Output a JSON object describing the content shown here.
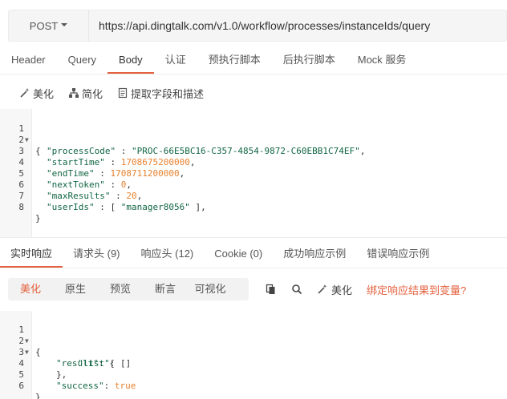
{
  "url_bar": {
    "method": "POST",
    "url": "https://api.dingtalk.com/v1.0/workflow/processes/instanceIds/query"
  },
  "request_tabs": [
    "Header",
    "Query",
    "Body",
    "认证",
    "预执行脚本",
    "后执行脚本",
    "Mock 服务"
  ],
  "request_active_tab": "Body",
  "body_toolbar": {
    "beautify": "美化",
    "simplify": "简化",
    "extract": "提取字段和描述"
  },
  "request_body": {
    "line_numbers": [
      "1",
      "2",
      "3",
      "4",
      "5",
      "6",
      "7",
      "8"
    ],
    "open_brace": "{",
    "close_brace": "}",
    "fields": [
      {
        "key": "\"processCode\"",
        "sep": " : ",
        "value": "\"PROC-66E5BC16-C357-4854-9872-C60EBB1C74EF\"",
        "tail": ","
      },
      {
        "key": "\"startTime\"",
        "sep": " : ",
        "value": "1708675200000",
        "tail": ","
      },
      {
        "key": "\"endTime\"",
        "sep": " : ",
        "value": "1708711200000",
        "tail": ","
      },
      {
        "key": "\"nextToken\"",
        "sep": " : ",
        "value": "0",
        "tail": ","
      },
      {
        "key": "\"maxResults\"",
        "sep": " : ",
        "value": "20",
        "tail": ","
      },
      {
        "key": "\"userIds\"",
        "sep": " : [ ",
        "value": "\"manager8056\"",
        "tail": " ],"
      }
    ]
  },
  "response_tabs": [
    "实时响应",
    "请求头 (9)",
    "响应头 (12)",
    "Cookie (0)",
    "成功响应示例",
    "错误响应示例"
  ],
  "response_active_tab": "实时响应",
  "response_views": [
    "美化",
    "原生",
    "预览",
    "断言",
    "可视化"
  ],
  "response_active_view": "美化",
  "response_tools": {
    "copy_icon": "copy-icon",
    "search_icon": "search-icon",
    "beautify": "美化",
    "bind_vars": "绑定响应结果到变量?"
  },
  "response_body": {
    "line_numbers": [
      "1",
      "2",
      "3",
      "4",
      "5",
      "6"
    ],
    "line1": "{",
    "result_key": "\"result\"",
    "result_open": ": {",
    "list_key": "\"list\"",
    "list_val": ": []",
    "result_close": "},",
    "success_key": "\"success\"",
    "success_sep": ": ",
    "success_val": "true",
    "line6": "}"
  },
  "colors": {
    "accent": "#e4603f",
    "json_key": "#116644",
    "json_number": "#e8822f"
  }
}
